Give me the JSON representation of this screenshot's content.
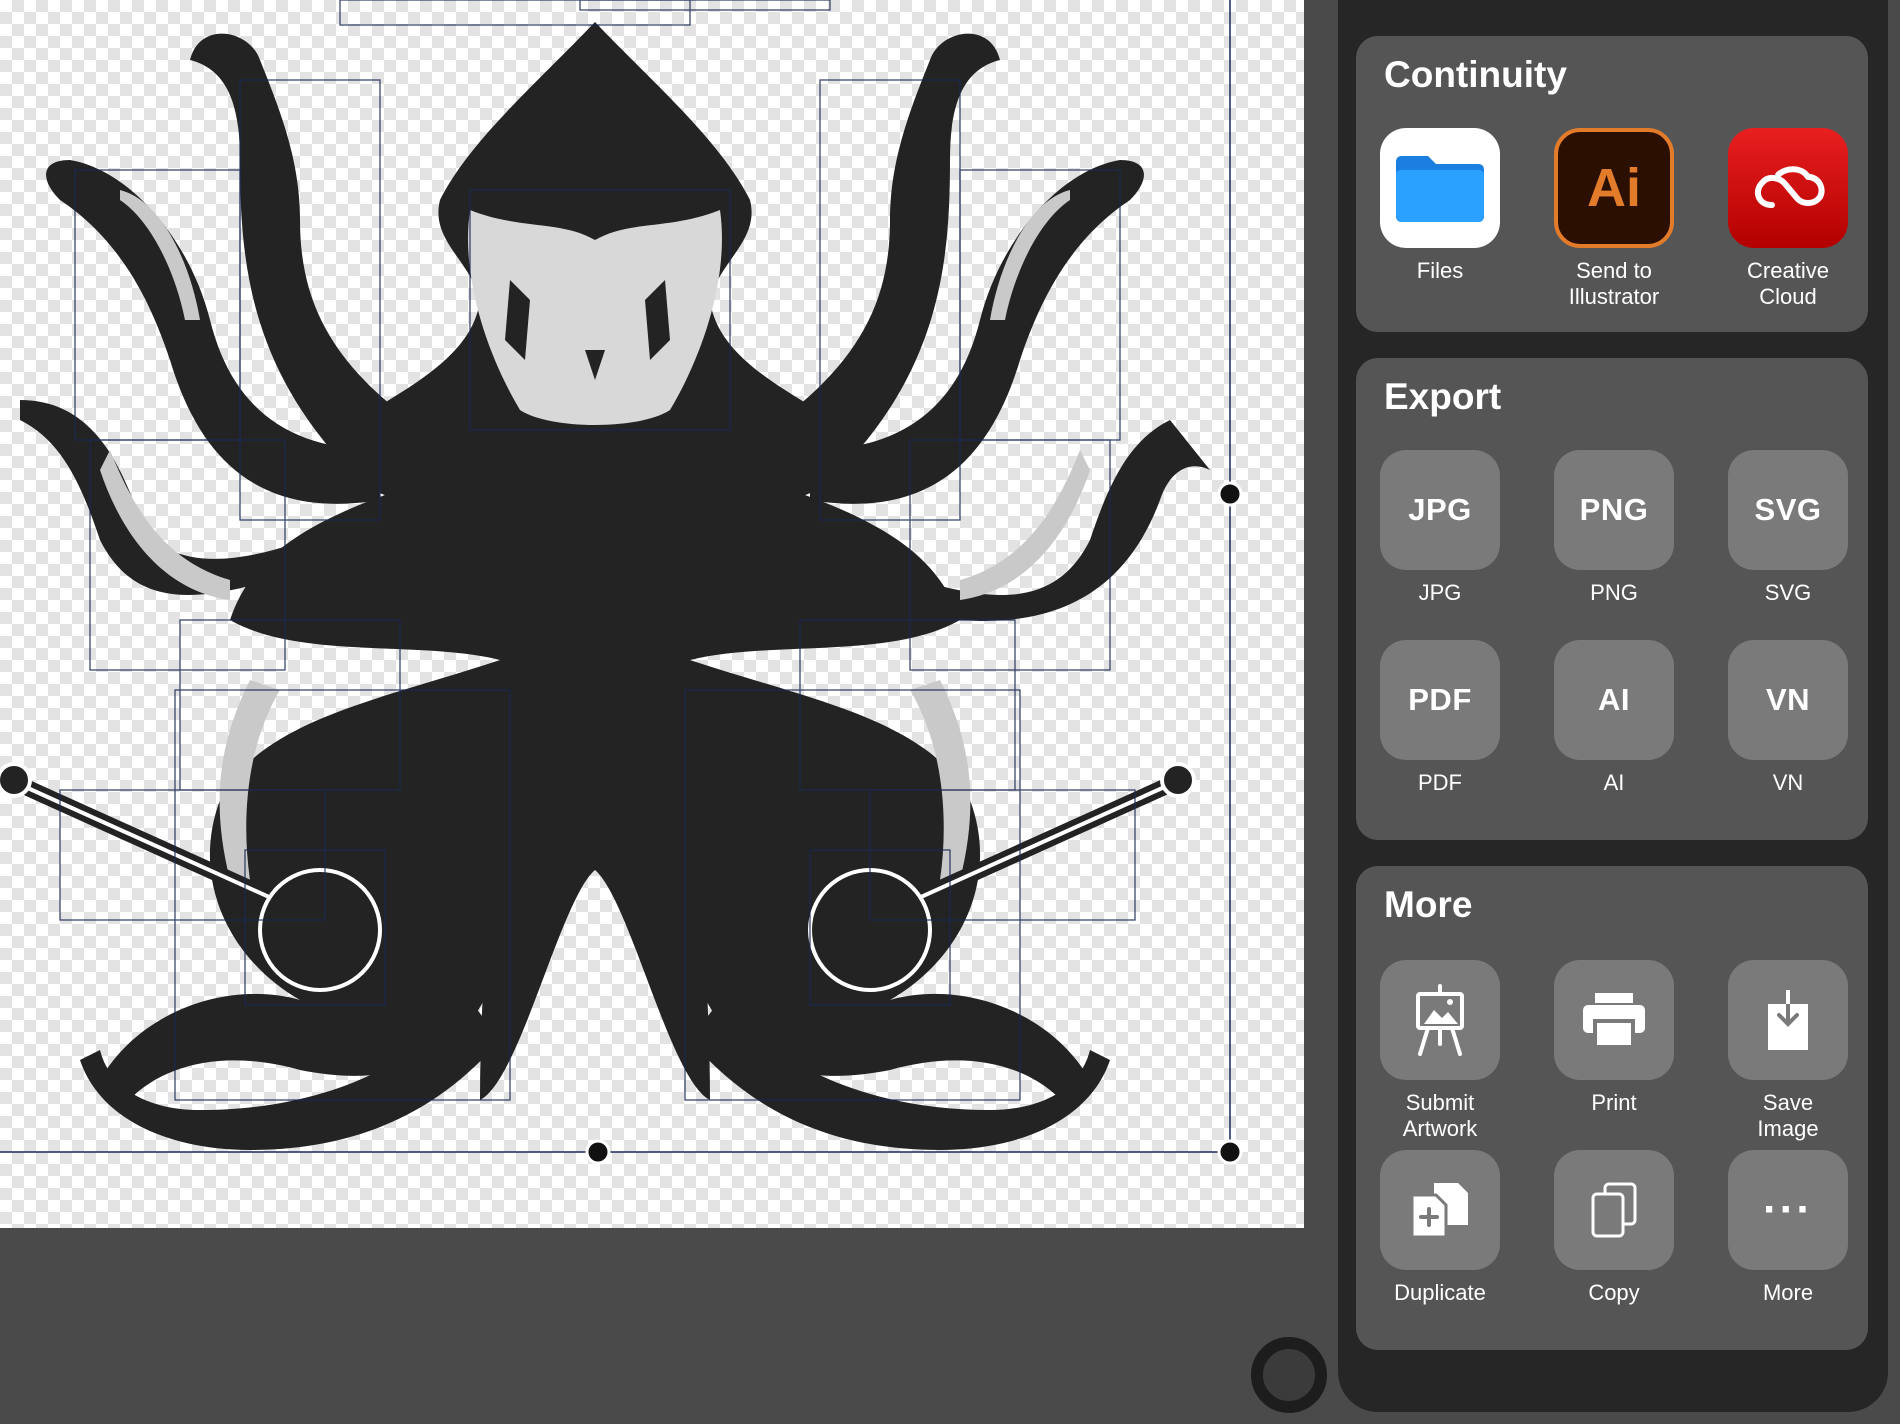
{
  "canvas": {
    "artwork": "octopus-vector-illustration"
  },
  "panel": {
    "continuity": {
      "title": "Continuity",
      "items": [
        {
          "label": "Files",
          "icon": "folder-icon"
        },
        {
          "label": "Send to\nIllustrator",
          "icon": "illustrator-icon",
          "glyph": "Ai"
        },
        {
          "label": "Creative\nCloud",
          "icon": "creative-cloud-icon"
        }
      ]
    },
    "export": {
      "title": "Export",
      "items": [
        {
          "label": "JPG",
          "glyph": "JPG"
        },
        {
          "label": "PNG",
          "glyph": "PNG"
        },
        {
          "label": "SVG",
          "glyph": "SVG"
        },
        {
          "label": "PDF",
          "glyph": "PDF"
        },
        {
          "label": "AI",
          "glyph": "AI"
        },
        {
          "label": "VN",
          "glyph": "VN"
        }
      ]
    },
    "more": {
      "title": "More",
      "items": [
        {
          "label": "Submit\nArtwork",
          "icon": "easel-icon"
        },
        {
          "label": "Print",
          "icon": "printer-icon"
        },
        {
          "label": "Save\nImage",
          "icon": "save-image-icon"
        },
        {
          "label": "Duplicate",
          "icon": "duplicate-icon"
        },
        {
          "label": "Copy",
          "icon": "copy-icon"
        },
        {
          "label": "More",
          "icon": "ellipsis-icon",
          "glyph": "···"
        }
      ]
    }
  },
  "colors": {
    "panel_bg": "#262626",
    "card_bg": "#555555",
    "tile_bg": "#7a7a7a",
    "artwork": "#232323",
    "selection": "#1b2a55",
    "illustrator_orange": "#e27b2a",
    "cc_red": "#d40000",
    "files_blue": "#1e90ff"
  }
}
